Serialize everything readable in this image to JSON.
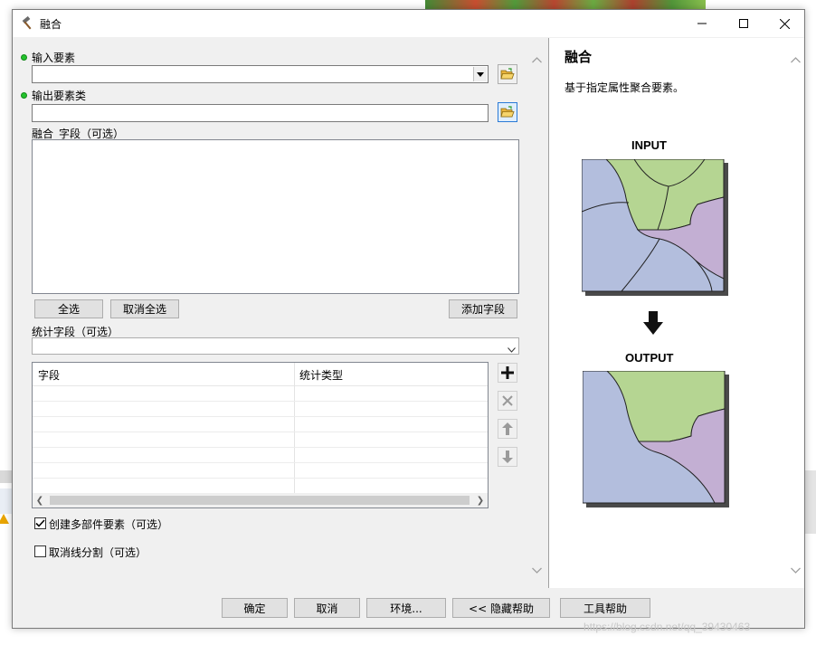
{
  "window": {
    "title": "融合",
    "icon": "hammer-icon"
  },
  "form": {
    "input_features_label": "输入要素",
    "input_features_value": "",
    "output_feature_class_label": "输出要素类",
    "output_feature_class_value": "",
    "dissolve_field_label": "融合_字段（可选）",
    "select_all": "全选",
    "unselect_all": "取消全选",
    "add_field": "添加字段",
    "statistics_fields_label": "统计字段（可选）",
    "statistics_fields_value": "",
    "stats_grid": {
      "columns": [
        "字段",
        "统计类型"
      ],
      "rows": []
    },
    "multipart": {
      "label": "创建多部件要素（可选）",
      "checked": true
    },
    "unsplit": {
      "label": "取消线分割（可选）",
      "checked": false
    }
  },
  "help": {
    "title": "融合",
    "description": "基于指定属性聚合要素。",
    "input_label": "INPUT",
    "output_label": "OUTPUT",
    "colors": {
      "green": "#b5d592",
      "blue": "#b3bedd",
      "purple": "#c3afd3"
    }
  },
  "buttons": {
    "ok": "确定",
    "cancel": "取消",
    "environments": "环境...",
    "hide_help": "<< 隐藏帮助",
    "tool_help": "工具帮助"
  },
  "watermark": "https://blog.csdn.net/qq_39430463"
}
